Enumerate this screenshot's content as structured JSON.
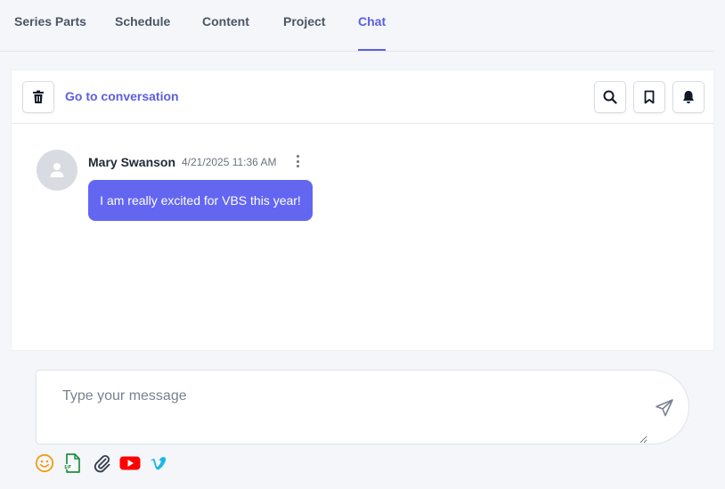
{
  "tabs": [
    {
      "label": "Series Parts"
    },
    {
      "label": "Schedule"
    },
    {
      "label": "Content"
    },
    {
      "label": "Project"
    },
    {
      "label": "Chat",
      "active": true
    }
  ],
  "toolbar": {
    "delete_icon": "trash-icon",
    "goto_label": "Go to conversation",
    "search_icon": "search-icon",
    "bookmark_icon": "bookmark-icon",
    "notify_icon": "bell-icon"
  },
  "messages": [
    {
      "author": "Mary Swanson",
      "timestamp": "4/21/2025 11:36 AM",
      "text": "I am really excited for VBS this year!",
      "avatar_icon": "user-placeholder-icon"
    }
  ],
  "composer": {
    "placeholder": "Type your message",
    "send_icon": "send-icon"
  },
  "attachments": [
    {
      "icon": "emoji-icon",
      "color": "#f39c12"
    },
    {
      "icon": "gif-icon",
      "color": "#1e8e3e"
    },
    {
      "icon": "paperclip-icon",
      "color": "#374151"
    },
    {
      "icon": "youtube-icon",
      "color": "#ff0000"
    },
    {
      "icon": "vimeo-icon",
      "color": "#1ab7ea"
    }
  ],
  "colors": {
    "accent": "#5b5fe0",
    "bubble": "#6366f1",
    "background": "#f4f6fa"
  }
}
